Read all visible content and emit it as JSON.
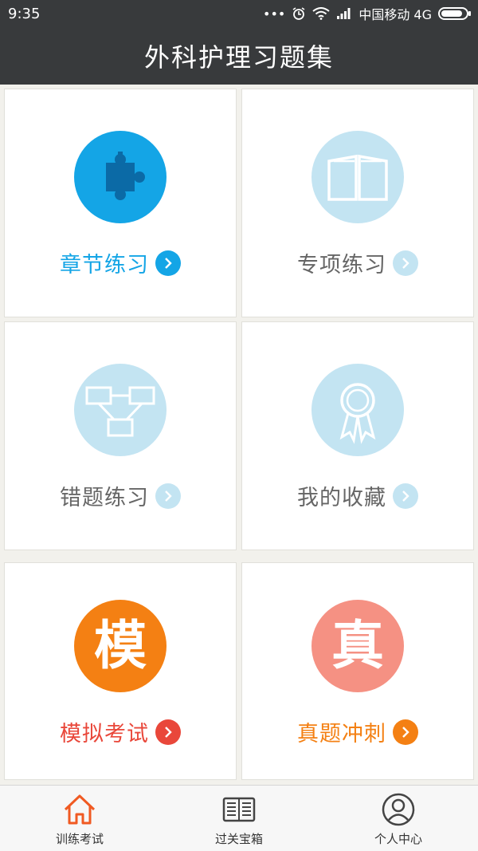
{
  "status": {
    "time": "9:35",
    "carrier": "中国移动 4G",
    "dots": "•••"
  },
  "header": {
    "title": "外科护理习题集"
  },
  "colors": {
    "header_bg": "#383a3c",
    "blue": "#14a5e6",
    "light_blue": "#c3e4f2",
    "orange": "#f48013",
    "red": "#e9473a",
    "salmon": "#f59183"
  },
  "cards": [
    {
      "label": "章节练习",
      "icon": "puzzle-icon"
    },
    {
      "label": "专项练习",
      "icon": "book-icon"
    },
    {
      "label": "错题练习",
      "icon": "flowchart-icon"
    },
    {
      "label": "我的收藏",
      "icon": "ribbon-badge-icon"
    },
    {
      "label": "模拟考试",
      "icon_char": "模"
    },
    {
      "label": "真题冲刺",
      "icon_char": "真"
    }
  ],
  "tabs": [
    {
      "label": "训练考试",
      "icon": "home-icon",
      "active": true
    },
    {
      "label": "过关宝箱",
      "icon": "news-icon",
      "active": false
    },
    {
      "label": "个人中心",
      "icon": "user-icon",
      "active": false
    }
  ]
}
